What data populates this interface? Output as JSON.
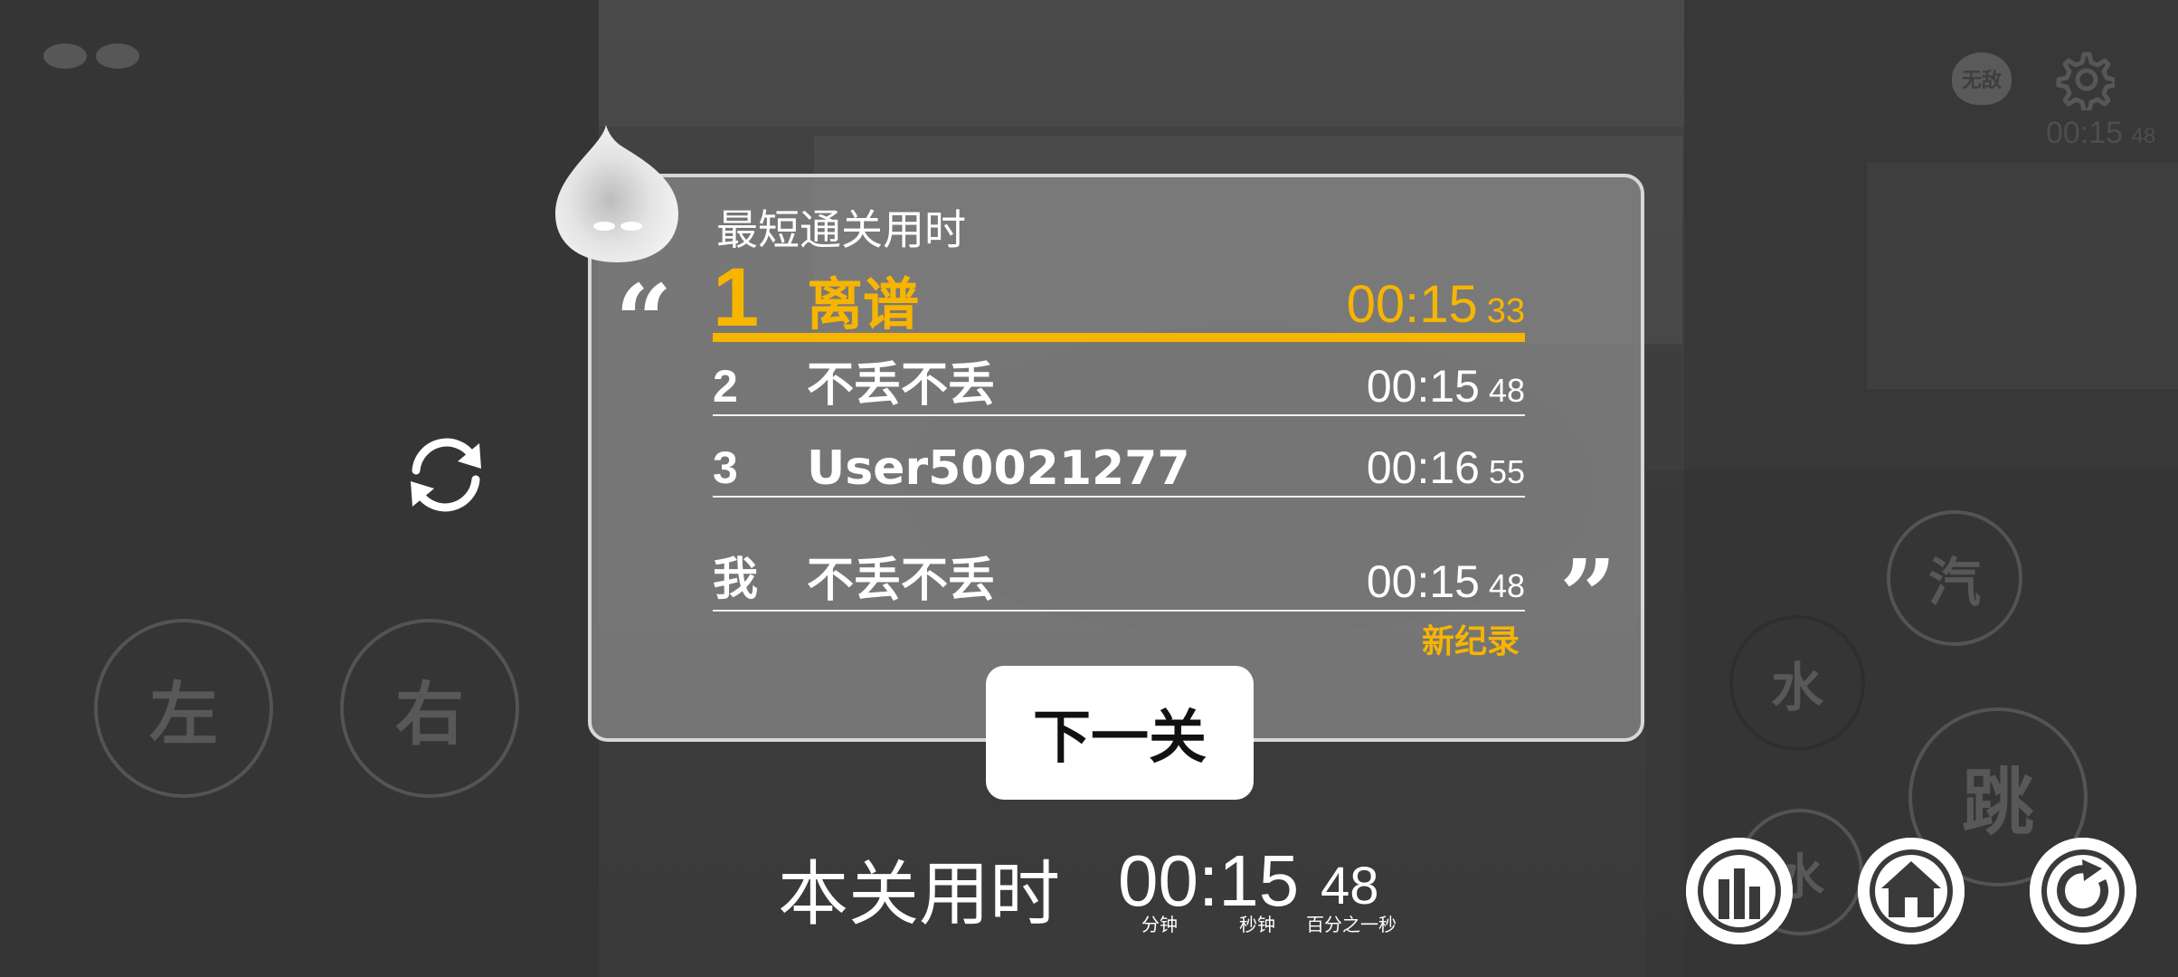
{
  "background_controls": {
    "left": "左",
    "right": "右",
    "steam": "汽",
    "water": "水",
    "jump": "跳",
    "partial": "水"
  },
  "top_right": {
    "invincible_label": "无敌",
    "timer_main": "00:15",
    "timer_cs": "48",
    "settings_icon": "gear-icon"
  },
  "leaderboard": {
    "title": "最短通关用时",
    "entries": [
      {
        "rank": "1",
        "name": "离谱",
        "time": "00:15",
        "cs": "33"
      },
      {
        "rank": "2",
        "name": "不丢不丢",
        "time": "00:15",
        "cs": "48"
      },
      {
        "rank": "3",
        "name": "User50021277",
        "time": "00:16",
        "cs": "55"
      }
    ],
    "me": {
      "rank": "我",
      "name": "不丢不丢",
      "time": "00:15",
      "cs": "48"
    },
    "new_record": "新纪录",
    "highlight_color": "#f7b500"
  },
  "next_button": "下一关",
  "this_level": {
    "label": "本关用时",
    "time": "00:15",
    "cs": "48",
    "unit_minutes": "分钟",
    "unit_seconds": "秒钟",
    "unit_cs": "百分之一秒"
  },
  "bottom_buttons": [
    "leaderboard-icon",
    "home-icon",
    "restart-icon"
  ]
}
